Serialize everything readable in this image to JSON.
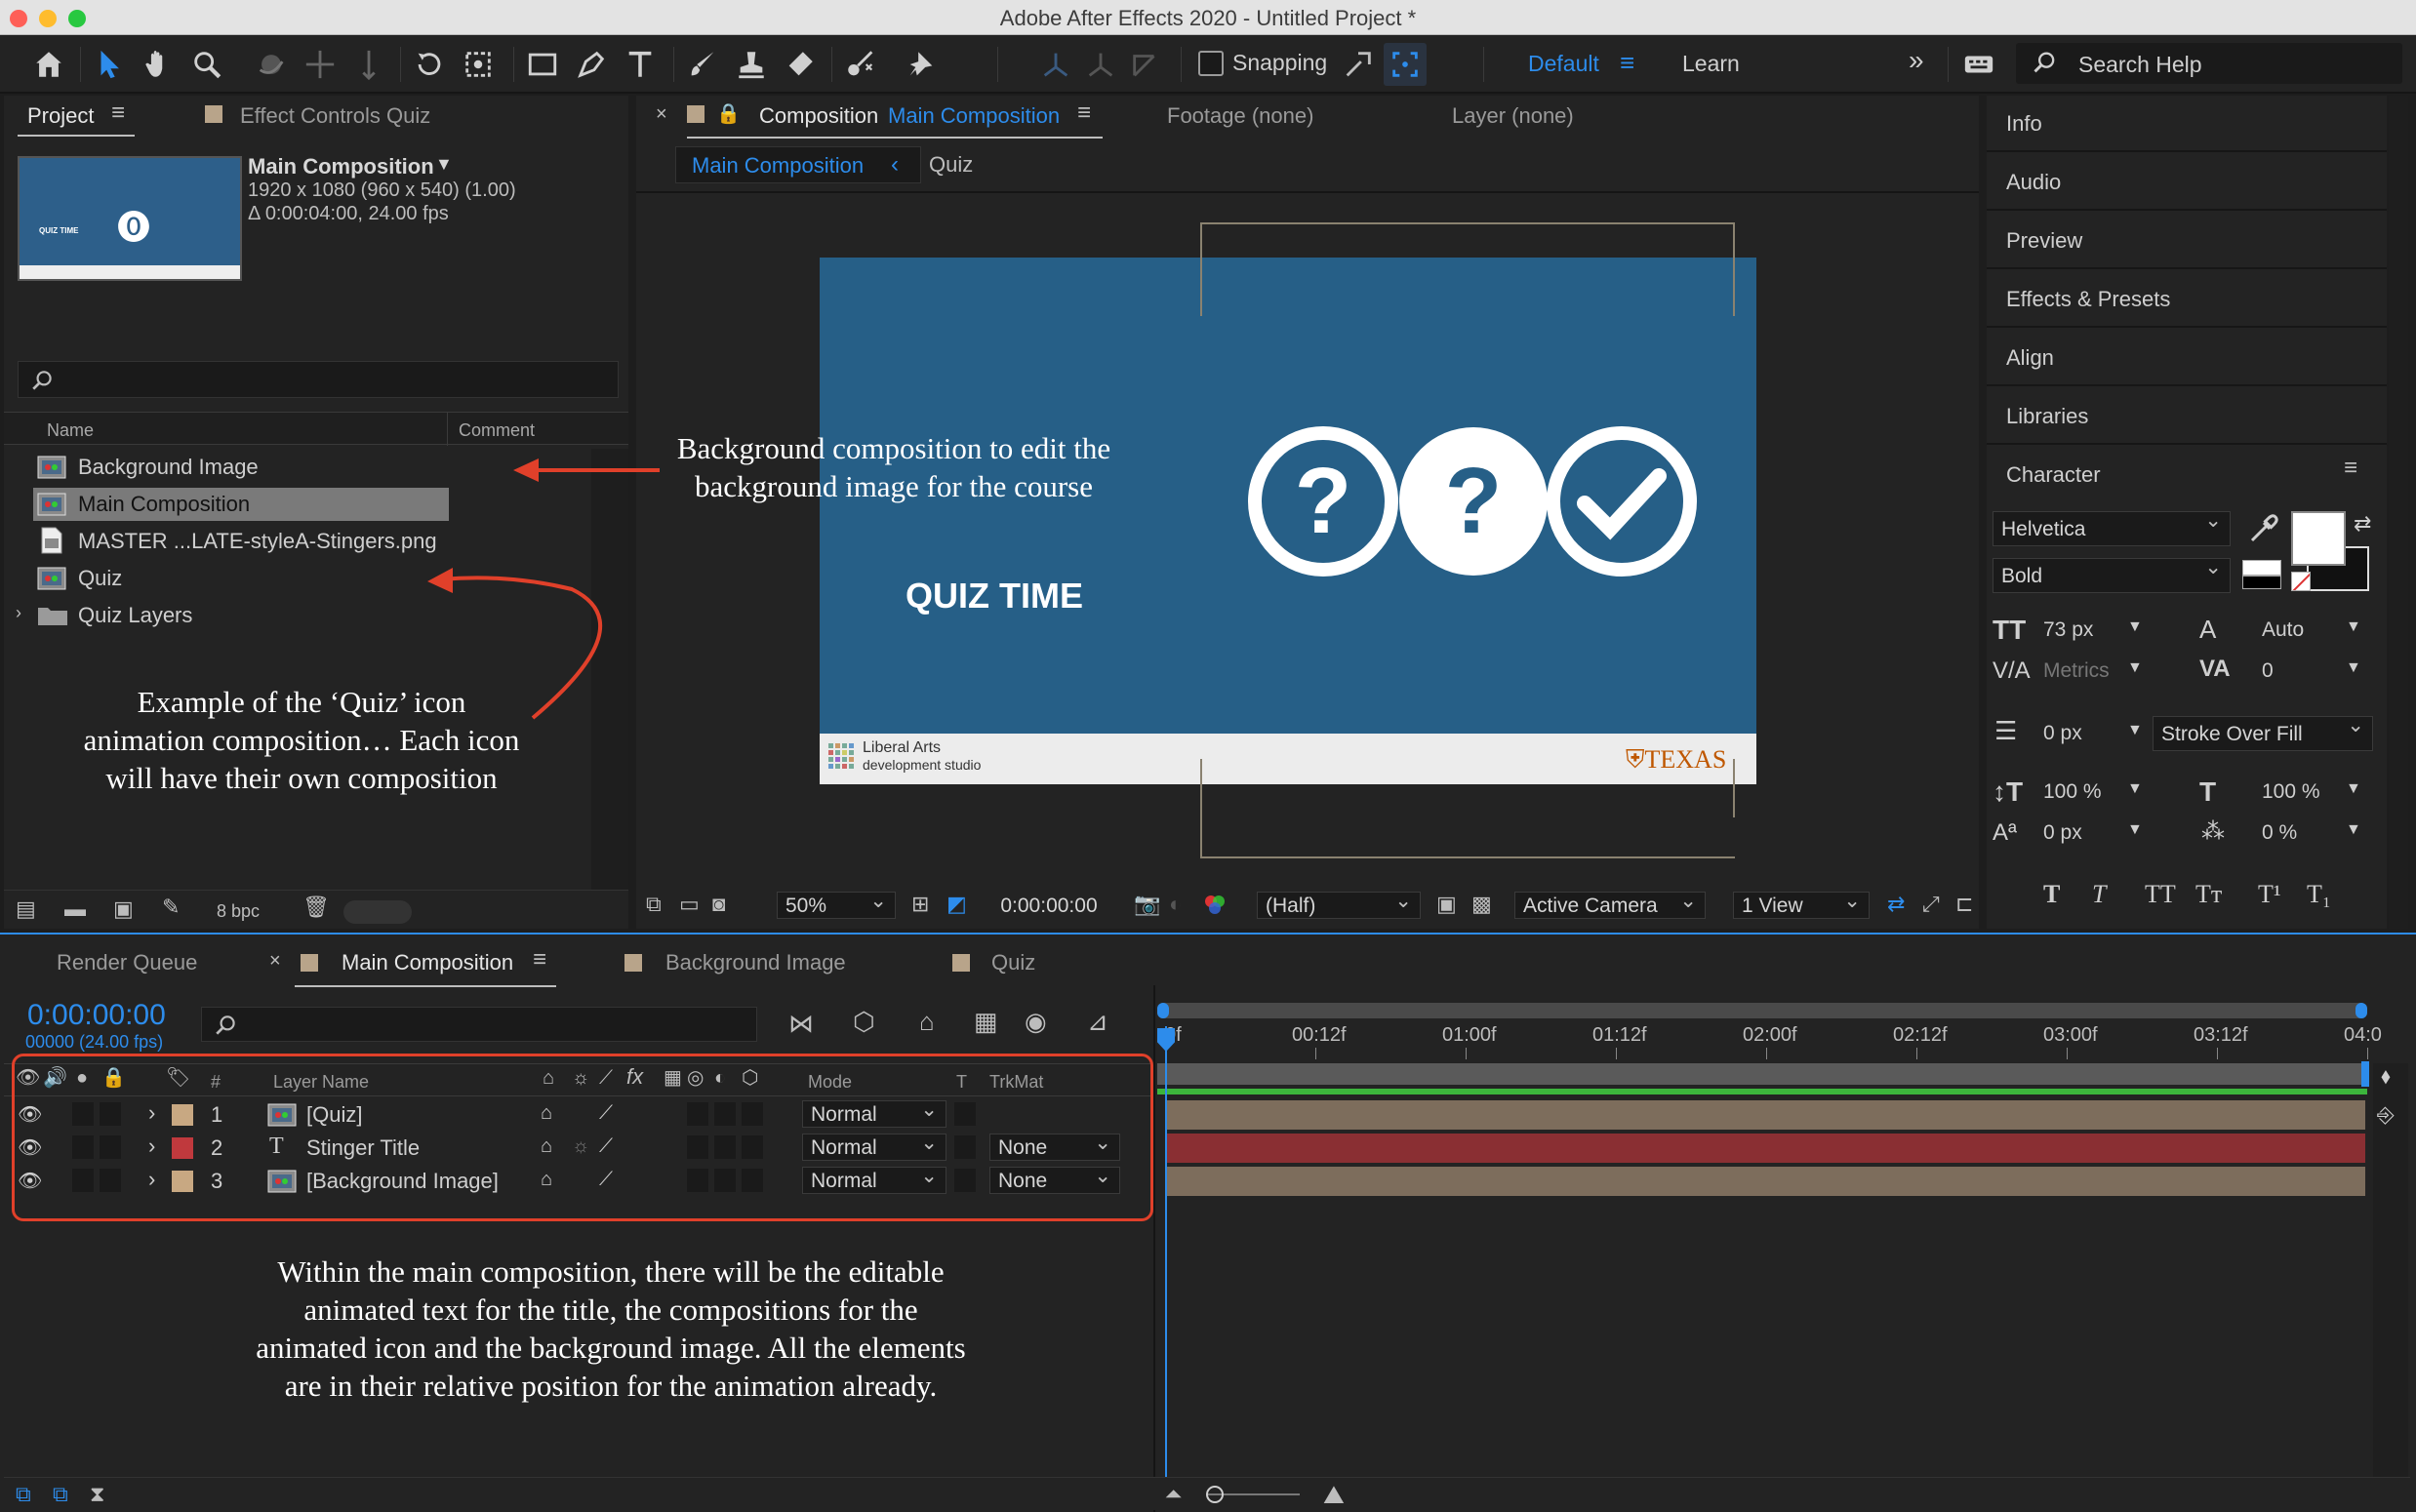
{
  "window": {
    "title": "Adobe After Effects 2020 - Untitled Project *"
  },
  "toolbar": {
    "snapping_label": "Snapping",
    "workspace_default": "Default",
    "workspace_learn": "Learn",
    "search_placeholder": "Search Help"
  },
  "project_panel": {
    "tab_project": "Project",
    "tab_effect_controls": "Effect Controls Quiz",
    "selected_name": "Main Composition",
    "selected_dims": "1920 x 1080  (960 x 540) (1.00)",
    "selected_duration": "Δ 0:00:04:00, 24.00 fps",
    "thumb_text": "QUIZ TIME",
    "col_name": "Name",
    "col_comment": "Comment",
    "items": [
      {
        "label": "Background Image",
        "icon": "composition-icon"
      },
      {
        "label": "Main Composition",
        "icon": "composition-icon"
      },
      {
        "label": "MASTER ...LATE-styleA-Stingers.png",
        "icon": "image-file-icon"
      },
      {
        "label": "Quiz",
        "icon": "composition-icon"
      },
      {
        "label": "Quiz Layers",
        "icon": "folder-icon"
      }
    ],
    "bpc": "8 bpc"
  },
  "viewer": {
    "tab_composition_prefix": "Composition",
    "tab_composition_name": "Main Composition",
    "tab_footage": "Footage (none)",
    "tab_layer": "Layer (none)",
    "breadcrumb_main": "Main Composition",
    "breadcrumb_sub": "Quiz",
    "canvas_title": "QUIZ TIME",
    "logo_line1": "Liberal Arts",
    "logo_line2": "development studio",
    "brand_right": "TEXAS",
    "zoom": "50%",
    "timecode": "0:00:00:00",
    "resolution": "(Half)",
    "camera": "Active Camera",
    "views": "1 View"
  },
  "right_panels": {
    "items": [
      "Info",
      "Audio",
      "Preview",
      "Effects & Presets",
      "Align",
      "Libraries",
      "Character"
    ],
    "character": {
      "font": "Helvetica",
      "style": "Bold",
      "size": "73 px",
      "leading": "Auto",
      "kerning": "Metrics",
      "tracking": "0",
      "stroke_width": "0 px",
      "stroke_mode": "Stroke Over Fill",
      "vscale": "100 %",
      "hscale": "100 %",
      "baseline": "0 px",
      "tsume": "0 %"
    }
  },
  "timeline": {
    "tab_render_queue": "Render Queue",
    "tab_main": "Main Composition",
    "tab_bg": "Background Image",
    "tab_quiz": "Quiz",
    "current_time": "0:00:00:00",
    "frame_info": "00000 (24.00 fps)",
    "col_num": "#",
    "col_layer_name": "Layer Name",
    "col_mode": "Mode",
    "col_t": "T",
    "col_trkmat": "TrkMat",
    "ruler": [
      "0f",
      "00:12f",
      "01:00f",
      "01:12f",
      "02:00f",
      "02:12f",
      "03:00f",
      "03:12f",
      "04:0"
    ],
    "layers": [
      {
        "num": "1",
        "name": "[Quiz]",
        "mode": "Normal",
        "trkmat": "",
        "label_color": "#c8a882",
        "bar_color": "#7d6d5c"
      },
      {
        "num": "2",
        "name": "Stinger Title",
        "mode": "Normal",
        "trkmat": "None",
        "label_color": "#c0393d",
        "bar_color": "#8a2f33"
      },
      {
        "num": "3",
        "name": "[Background Image]",
        "mode": "Normal",
        "trkmat": "None",
        "label_color": "#c8a882",
        "bar_color": "#7d6d5c"
      }
    ]
  },
  "annotations": {
    "background_note": "Background composition to edit the background image for the course",
    "quiz_note": "Example of the ‘Quiz’ icon animation composition… Each icon will have their own composition",
    "main_note": "Within the main composition, there will be the editable animated  text for the title, the compositions for the animated icon and the background image. All the elements are in their relative position for the animation already."
  },
  "colors": {
    "accent_blue": "#2d8ceb",
    "slide_blue": "#265f87",
    "annotation_red": "#e0402a"
  }
}
